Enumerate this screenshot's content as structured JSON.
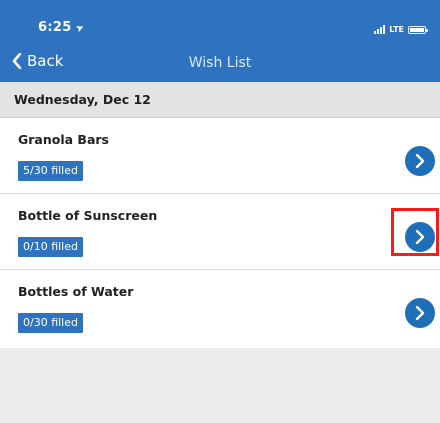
{
  "status_bar": {
    "time": "6:25",
    "network": "LTE",
    "battery_level": 1.0
  },
  "nav": {
    "back_label": "Back",
    "title": "Wish List"
  },
  "section": {
    "date": "Wednesday, Dec 12"
  },
  "items": [
    {
      "name": "Granola Bars",
      "status": "5/30 filled",
      "filled": 5,
      "total": 30
    },
    {
      "name": "Bottle of Sunscreen",
      "status": "0/10 filled",
      "filled": 0,
      "total": 10
    },
    {
      "name": "Bottles of Water",
      "status": "0/30 filled",
      "filled": 0,
      "total": 30
    }
  ],
  "colors": {
    "accent": "#2f73c0",
    "highlight": "#ff1a1a",
    "background": "#ececec"
  },
  "icons": {
    "location": "location-arrow-icon",
    "signal": "signal-icon",
    "battery": "battery-icon",
    "back": "chevron-left-icon",
    "go": "chevron-right-circle-icon"
  }
}
